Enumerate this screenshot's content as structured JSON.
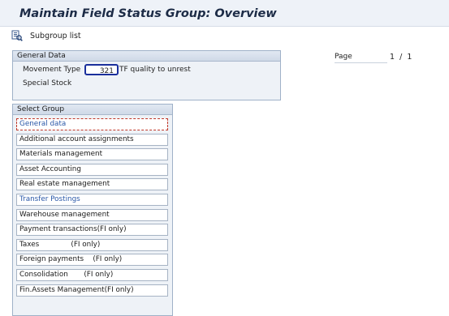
{
  "window": {
    "title": "Maintain Field Status Group: Overview"
  },
  "toolbar": {
    "subgroup_label": "Subgroup list",
    "subgroup_icon": "subgroup-list-icon"
  },
  "general_data": {
    "header": "General Data",
    "movement_type_label": "Movement Type",
    "movement_type_value": "321",
    "movement_type_desc": "TF quality to unrest",
    "special_stock_label": "Special Stock"
  },
  "page": {
    "label": "Page",
    "current": "1",
    "separator": "/",
    "total": "1"
  },
  "select_group": {
    "header": "Select Group",
    "items": [
      {
        "label": "General data",
        "style": "active"
      },
      {
        "label": "Additional account assignments",
        "style": "normal"
      },
      {
        "label": "Materials management",
        "style": "normal"
      },
      {
        "label": "Asset Accounting",
        "style": "normal"
      },
      {
        "label": "Real estate management",
        "style": "normal"
      },
      {
        "label": "Transfer Postings",
        "style": "link"
      },
      {
        "label": "Warehouse management",
        "style": "normal"
      },
      {
        "label": "Payment transactions(FI only)",
        "style": "normal"
      },
      {
        "label": "Taxes              (FI only)",
        "style": "normal"
      },
      {
        "label": "Foreign payments    (FI only)",
        "style": "normal"
      },
      {
        "label": "Consolidation       (FI only)",
        "style": "normal"
      },
      {
        "label": "Fin.Assets Management(FI only)",
        "style": "normal"
      }
    ]
  },
  "colors": {
    "title": "#1c2b46",
    "link": "#2a58a8",
    "focus_border": "#1a2f9c",
    "panel_bg": "#eef2f7"
  }
}
